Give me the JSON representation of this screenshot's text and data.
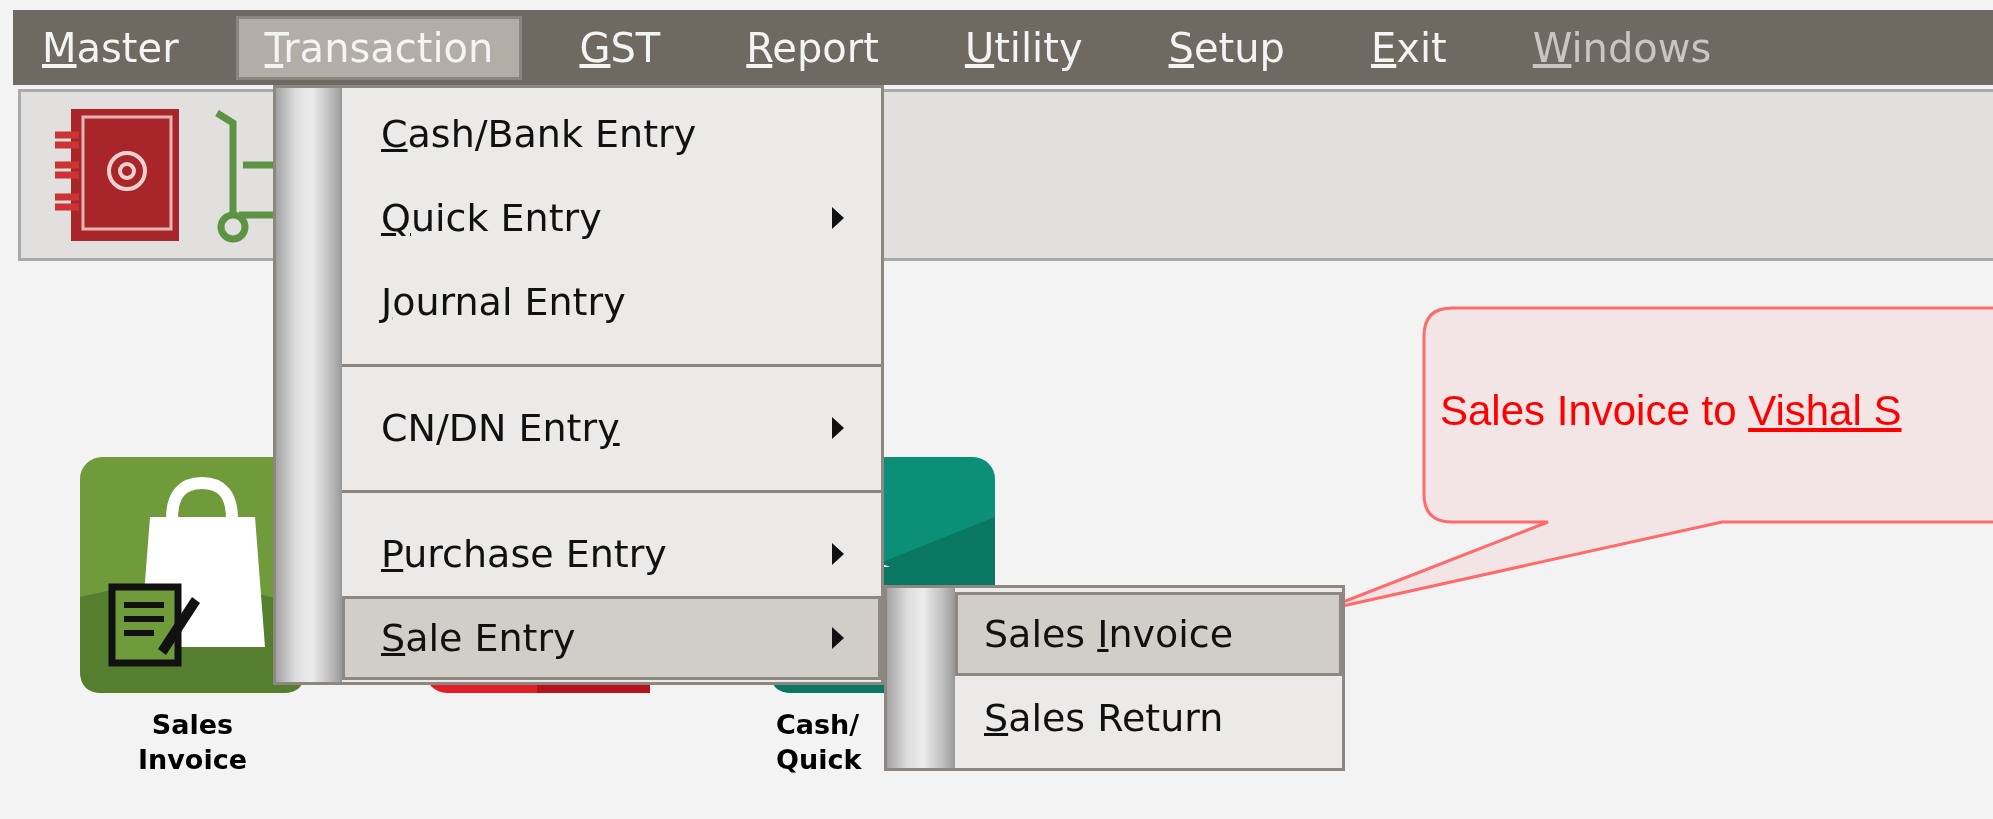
{
  "menubar": [
    {
      "key": "M",
      "after": "aster",
      "selected": false,
      "disabled": false
    },
    {
      "key": "T",
      "after": "ransaction",
      "selected": true,
      "disabled": false
    },
    {
      "key": "G",
      "after": "ST",
      "selected": false,
      "disabled": false
    },
    {
      "key": "R",
      "after": "eport",
      "selected": false,
      "disabled": false
    },
    {
      "key": "U",
      "after": "tility",
      "selected": false,
      "disabled": false
    },
    {
      "key": "S",
      "after": "etup",
      "selected": false,
      "disabled": false
    },
    {
      "key": "E",
      "after": "xit",
      "selected": false,
      "disabled": false
    },
    {
      "key": "W",
      "after": "indows",
      "selected": false,
      "disabled": true
    }
  ],
  "transaction_menu": [
    {
      "kind": "item",
      "key": "C",
      "after": "ash/Bank Entry",
      "submenu": false,
      "selected": false
    },
    {
      "kind": "item",
      "key": "Q",
      "after": "uick Entry",
      "submenu": true,
      "selected": false
    },
    {
      "kind": "item",
      "key": "J",
      "after": "ournal Entry",
      "submenu": false,
      "selected": false
    },
    {
      "kind": "separator"
    },
    {
      "kind": "item",
      "before": "CN/DN Entr",
      "key": "y",
      "submenu": true,
      "selected": false
    },
    {
      "kind": "separator"
    },
    {
      "kind": "item",
      "key": "P",
      "after": "urchase Entry",
      "submenu": true,
      "selected": false
    },
    {
      "kind": "item",
      "key": "S",
      "after": "ale Entry",
      "submenu": true,
      "selected": true
    }
  ],
  "sale_submenu": [
    {
      "before": "Sales ",
      "key": "I",
      "after": "nvoice",
      "selected": true
    },
    {
      "key": "S",
      "after": "ales Return",
      "selected": false
    }
  ],
  "tiles": [
    {
      "kind": "shopping",
      "label_lines": [
        "Sales",
        "Invoice"
      ]
    },
    {
      "kind": "banner"
    },
    {
      "kind": "bank",
      "label_lines": [
        "Cash/",
        "Quick"
      ]
    }
  ],
  "callout": {
    "text": "Sales Invoice to ",
    "link": "Vishal S"
  }
}
